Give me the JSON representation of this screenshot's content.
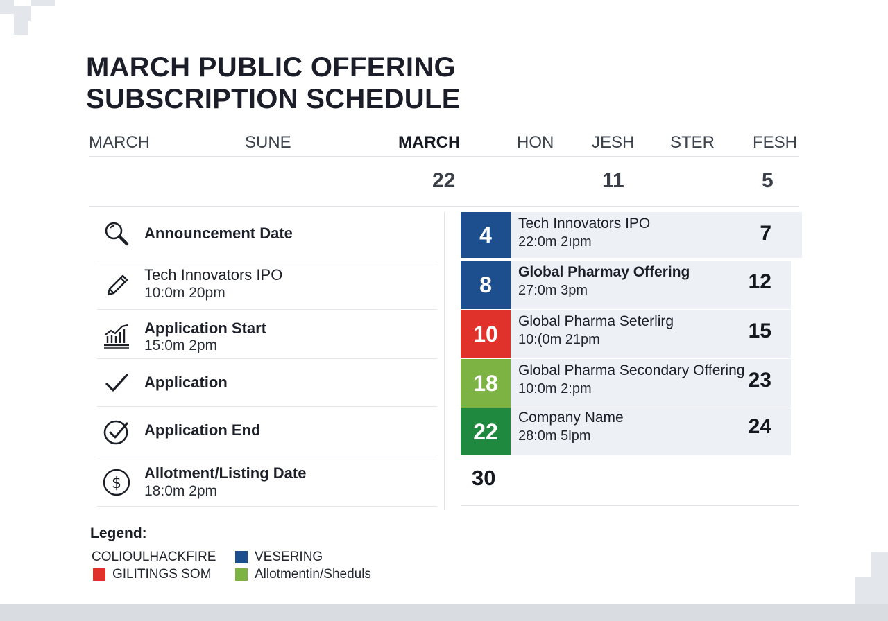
{
  "title": {
    "line1": "MARCH PUBLIC OFFERING",
    "line2": "SUBSCRIPTION SCHEDULE"
  },
  "months": [
    "MARCH",
    "SUNE",
    "MARCH",
    "HON",
    "JESH",
    "STER",
    "FESH"
  ],
  "active_month_index": 2,
  "header_dates": [
    "22",
    "11",
    "5"
  ],
  "events": [
    {
      "icon": "search-icon",
      "name": "Announcement Date",
      "time": ""
    },
    {
      "icon": "pen-icon",
      "name": "Tech Innovators IPO",
      "time": "10:0m 20pm"
    },
    {
      "icon": "chart-icon",
      "name": "Application Start",
      "time": "15:0m 2pm"
    },
    {
      "icon": "checkmark-icon",
      "name": "Application",
      "time": ""
    },
    {
      "icon": "check-circle-icon",
      "name": "Application End",
      "time": ""
    },
    {
      "icon": "dollar-icon",
      "name": "Allotment/Listing Date",
      "time": "18:0m 2pm"
    }
  ],
  "schedule": [
    {
      "start": "4",
      "name": "Tech Innovators IPO",
      "time": "22:0m 2ıpm",
      "end": "7",
      "color": "#1d4f8f"
    },
    {
      "start": "8",
      "name": "Global Pharmay Offering",
      "time": "27:0m 3pm",
      "end": "12",
      "color": "#1d4f8f"
    },
    {
      "start": "10",
      "name": "Global Pharma Seterlirg",
      "time": "10:(0m 21pm",
      "end": "15",
      "color": "#e0322b"
    },
    {
      "start": "18",
      "name": "Global Pharma Secondary Offering",
      "time": "10:0m 2:pm",
      "end": "23",
      "color": "#7cb342"
    },
    {
      "start": "22",
      "name": "Company Name",
      "time": "28:0m 5lpm",
      "end": "24",
      "color": "#1f8a3f"
    }
  ],
  "last_day": "30",
  "legend": {
    "title": "Legend:",
    "items": [
      {
        "label": "COLIOULHACKFIRE",
        "color": ""
      },
      {
        "label": "VESERING",
        "color": "#1d4f8f"
      },
      {
        "label": "GILITINGS SOM",
        "color": "#e0322b"
      },
      {
        "label": "Allotmentin/Sheduls",
        "color": "#7cb342"
      }
    ]
  }
}
